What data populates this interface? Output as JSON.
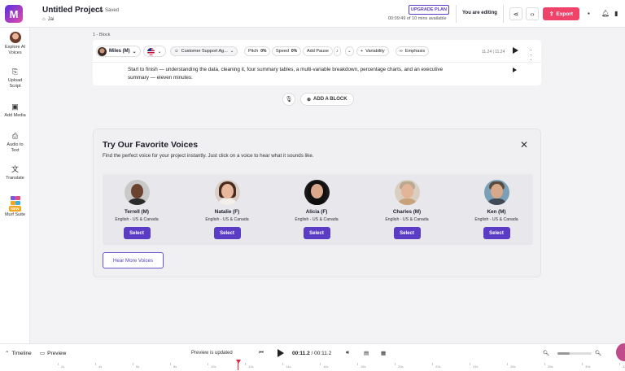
{
  "topbar": {
    "logo_glyph": "M",
    "project_title": "Untitled Project",
    "saved_label": "Saved",
    "breadcrumb_label": "Jai",
    "upgrade_label": "UPGRADE PLAN",
    "mins_available": "00:09:49 of 10 mins available",
    "editing_label": "You are editing",
    "export_label": "Export"
  },
  "sidebar": {
    "items": [
      {
        "label_1": "Explore AI",
        "label_2": "Voices"
      },
      {
        "label_1": "Upload",
        "label_2": "Script"
      },
      {
        "label_1": "Add Media",
        "label_2": ""
      },
      {
        "label_1": "Audio to",
        "label_2": "Text"
      },
      {
        "label_1": "Translate",
        "label_2": ""
      },
      {
        "label_1": "Murf Suite",
        "label_2": "",
        "badge": "NEW"
      }
    ]
  },
  "block": {
    "label": "1 - Block",
    "voice_name": "Miles (M)",
    "style": "Customer Support Ag...",
    "pitch_label": "Pitch",
    "pitch_value": "0%",
    "speed_label": "Speed",
    "speed_value": "0%",
    "pause_label": "Add Pause",
    "variability_label": "Variability",
    "emphasis_label": "Emphasis",
    "time": "11.24 | 11.24",
    "text": "Start to finish — understanding the data, cleaning it, four summary tables, a multi-variable breakdown, percentage charts, and an executive summary — eleven minutes."
  },
  "add_block_label": "ADD A BLOCK",
  "favorites": {
    "title": "Try Our Favorite Voices",
    "subtitle": "Find the perfect voice for your project instantly. Just click on a voice to hear what it sounds like.",
    "select_label": "Select",
    "hear_more_label": "Hear More Voices",
    "voices": [
      {
        "name": "Terrell (M)",
        "lang": "English - US & Canada"
      },
      {
        "name": "Natalie (F)",
        "lang": "English - US & Canada"
      },
      {
        "name": "Alicia (F)",
        "lang": "English - US & Canada"
      },
      {
        "name": "Charles (M)",
        "lang": "English - US & Canada"
      },
      {
        "name": "Ken (M)",
        "lang": "English - US & Canada"
      }
    ]
  },
  "bottombar": {
    "timeline_label": "Timeline",
    "preview_label": "Preview",
    "preview_status": "Preview is updated",
    "current_time": "00:11.2",
    "total_time": "00:11.2",
    "zoom_fraction": 0.35,
    "ruler_ticks": [
      "2s",
      "4s",
      "6s",
      "8s",
      "10s",
      "12s",
      "14s",
      "16s",
      "18s",
      "20s",
      "22s",
      "24s",
      "26s",
      "28s",
      "30s",
      "32s"
    ]
  },
  "colors": {
    "accent": "#5b3cc4",
    "export": "#f0436a",
    "playhead": "#e0243a"
  }
}
